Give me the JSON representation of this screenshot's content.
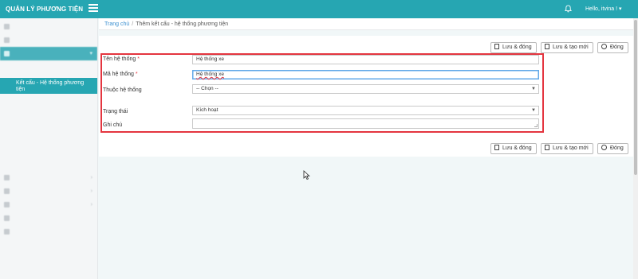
{
  "app": {
    "title": "QUẢN LÝ PHƯƠNG TIỆN",
    "greeting": "Hello, itvina !"
  },
  "icons": {
    "menu": "hamburger-icon",
    "notifications": "bell-icon",
    "save": "file-icon",
    "close": "close-circle-icon",
    "dropdown": "chevron-down-icon"
  },
  "breadcrumb": {
    "home": "Trang chủ",
    "separator": "/",
    "current": "Thêm kết cấu - hệ thống phương tiện"
  },
  "sidebar": {
    "active_item": "Kết cấu - Hệ thống phương tiện"
  },
  "toolbar": {
    "save_close": "Lưu & đóng",
    "save_new": "Lưu & tạo mới",
    "close": "Đóng"
  },
  "form": {
    "name": {
      "label": "Tên hệ thống",
      "required": "*",
      "value": "Hệ thống xe"
    },
    "code": {
      "label": "Mã hệ thống",
      "required": "*",
      "value": "Hệ thống xe"
    },
    "parent": {
      "label": "Thuộc hệ thống",
      "value": "-- Chọn --"
    },
    "status": {
      "label": "Trạng thái",
      "value": "Kích hoạt"
    },
    "note": {
      "label": "Ghi chú",
      "value": ""
    }
  },
  "colors": {
    "header": "#26a6b2",
    "highlight_border": "#e4353f",
    "link": "#3a8fd0"
  }
}
